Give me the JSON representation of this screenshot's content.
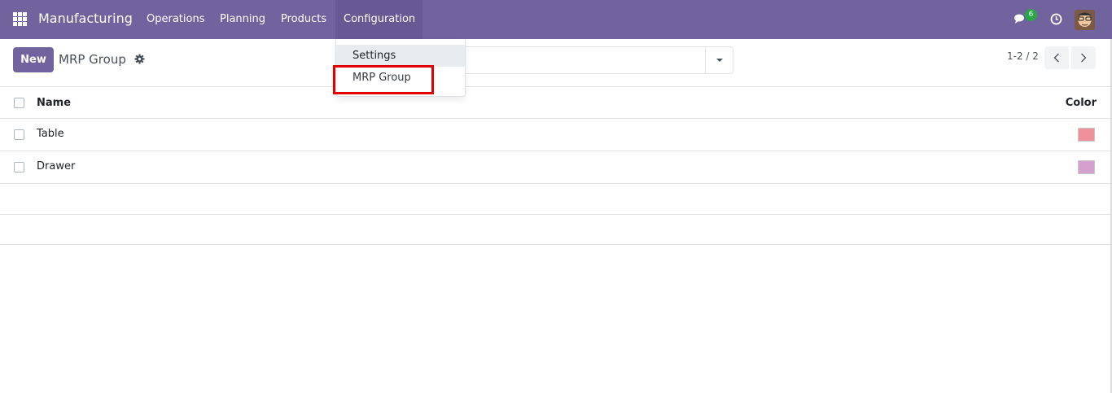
{
  "navbar": {
    "brand": "Manufacturing",
    "menu": [
      "Operations",
      "Planning",
      "Products",
      "Configuration"
    ],
    "chat_badge": "6"
  },
  "control_panel": {
    "new_label": "New",
    "title": "MRP Group",
    "pager": "1-2 / 2"
  },
  "dropdown": {
    "items": [
      "Settings",
      "MRP Group"
    ]
  },
  "list": {
    "columns": [
      "Name",
      "Color"
    ],
    "rows": [
      {
        "name": "Table",
        "color": "#f0909a"
      },
      {
        "name": "Drawer",
        "color": "#d5a0cd"
      }
    ]
  },
  "colors": {
    "navbar": "#71639e",
    "accent": "#71639e",
    "highlight": "#e30000"
  }
}
